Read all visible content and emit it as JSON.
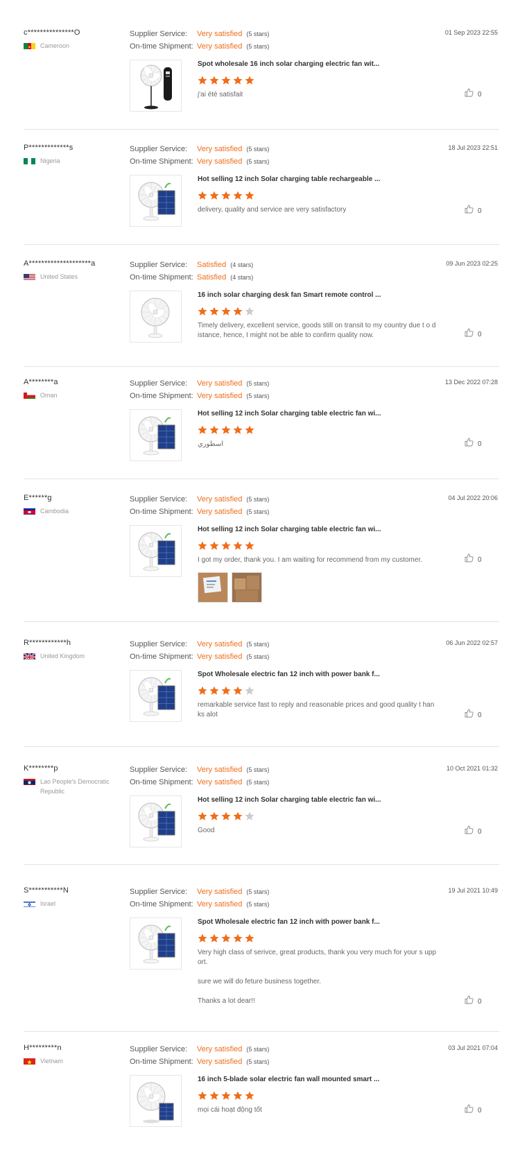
{
  "labels": {
    "supplier_service": "Supplier Service:",
    "on_time_shipment": "On-time Shipment:"
  },
  "colors": {
    "accent": "#f06d1a",
    "star_empty": "#cccccc",
    "separator": "#e3e3e3"
  },
  "reviews": [
    {
      "buyer": "c***************O",
      "country": "Cameroon",
      "flag": "cameroon",
      "supplier_service": "Very satisfied",
      "supplier_stars": "(5 stars)",
      "shipment": "Very satisfied",
      "shipment_stars": "(5 stars)",
      "date": "01 Sep 2023 22:55",
      "product": "Spot wholesale 16 inch solar charging electric fan wit...",
      "product_image": "standing-fan-with-battery-icon",
      "rating": 5,
      "comment": [
        "j'ai été satisfait"
      ],
      "likes": "0",
      "photos": []
    },
    {
      "buyer": "P*************s",
      "country": "Nigeria",
      "flag": "nigeria",
      "supplier_service": "Very satisfied",
      "supplier_stars": "(5 stars)",
      "shipment": "Very satisfied",
      "shipment_stars": "(5 stars)",
      "date": "18 Jul 2023 22:51",
      "product": "Hot selling 12 inch Solar charging table rechargeable ...",
      "product_image": "table-fan-with-solar-panel-icon",
      "rating": 5,
      "comment": [
        "delivery, quality and service are very satisfactory"
      ],
      "likes": "0",
      "photos": []
    },
    {
      "buyer": "A********************a",
      "country": "United States",
      "flag": "usa",
      "supplier_service": "Satisfied",
      "supplier_stars": "(4 stars)",
      "shipment": "Satisfied",
      "shipment_stars": "(4 stars)",
      "date": "09 Jun 2023 02:25",
      "product": "16 inch solar charging desk fan Smart remote control ...",
      "product_image": "desk-fan-icon",
      "rating": 4,
      "comment": [
        "Timely delivery, excellent service, goods still on transit to my country due t o distance, hence, I might not be able to confirm quality now."
      ],
      "likes": "0",
      "photos": []
    },
    {
      "buyer": "A********a",
      "country": "Oman",
      "flag": "oman",
      "supplier_service": "Very satisfied",
      "supplier_stars": "(5 stars)",
      "shipment": "Very satisfied",
      "shipment_stars": "(5 stars)",
      "date": "13 Dec 2022 07:28",
      "product": "Hot selling 12 inch Solar charging table electric fan wi...",
      "product_image": "table-fan-with-solar-panel-icon",
      "rating": 5,
      "comment": [
        "اسطوري"
      ],
      "likes": "0",
      "photos": []
    },
    {
      "buyer": "E******g",
      "country": "Cambodia",
      "flag": "cambodia",
      "supplier_service": "Very satisfied",
      "supplier_stars": "(5 stars)",
      "shipment": "Very satisfied",
      "shipment_stars": "(5 stars)",
      "date": "04 Jul 2022 20:06",
      "product": "Hot selling 12 inch Solar charging table electric fan wi...",
      "product_image": "table-fan-with-solar-panel-icon",
      "rating": 5,
      "comment": [
        "I got my order, thank you. I am waiting for recommend from my customer."
      ],
      "likes": "0",
      "photos": [
        "package-label-photo",
        "boxes-photo"
      ]
    },
    {
      "buyer": "R************h",
      "country": "United Kingdom",
      "flag": "uk",
      "supplier_service": "Very satisfied",
      "supplier_stars": "(5 stars)",
      "shipment": "Very satisfied",
      "shipment_stars": "(5 stars)",
      "date": "06 Jun 2022 02:57",
      "product": "Spot Wholesale electric fan 12 inch with power bank f...",
      "product_image": "table-fan-with-solar-panel-icon",
      "rating": 4,
      "comment": [
        "remarkable service fast to reply and reasonable prices and good quality t hanks alot"
      ],
      "likes": "0",
      "photos": []
    },
    {
      "buyer": "K********p",
      "country": "Lao People's Democratic Republic",
      "flag": "laos",
      "supplier_service": "Very satisfied",
      "supplier_stars": "(5 stars)",
      "shipment": "Very satisfied",
      "shipment_stars": "(5 stars)",
      "date": "10 Oct 2021 01:32",
      "product": "Hot selling 12 inch Solar charging table electric fan wi...",
      "product_image": "table-fan-with-solar-panel-icon",
      "rating": 4,
      "comment": [
        "Good"
      ],
      "likes": "0",
      "photos": []
    },
    {
      "buyer": "S***********N",
      "country": "Israel",
      "flag": "israel",
      "supplier_service": "Very satisfied",
      "supplier_stars": "(5 stars)",
      "shipment": "Very satisfied",
      "shipment_stars": "(5 stars)",
      "date": "19 Jul 2021 10:49",
      "product": "Spot Wholesale electric fan 12 inch with power bank f...",
      "product_image": "table-fan-with-solar-panel-icon",
      "rating": 5,
      "comment": [
        "Very high class of serivce, great products, thank you very much for your s upport.",
        "sure we will do feture business together.",
        "Thanks a lot dear!!"
      ],
      "likes": "0",
      "photos": []
    },
    {
      "buyer": "H*********n",
      "country": "Vietnam",
      "flag": "vietnam",
      "supplier_service": "Very satisfied",
      "supplier_stars": "(5 stars)",
      "shipment": "Very satisfied",
      "shipment_stars": "(5 stars)",
      "date": "03 Jul 2021 07:04",
      "product": "16 inch 5-blade solar electric fan wall mounted smart ...",
      "product_image": "fan-with-solar-panel-icon",
      "rating": 5,
      "comment": [
        "mọi cái hoạt động tốt"
      ],
      "likes": "0",
      "photos": []
    }
  ]
}
